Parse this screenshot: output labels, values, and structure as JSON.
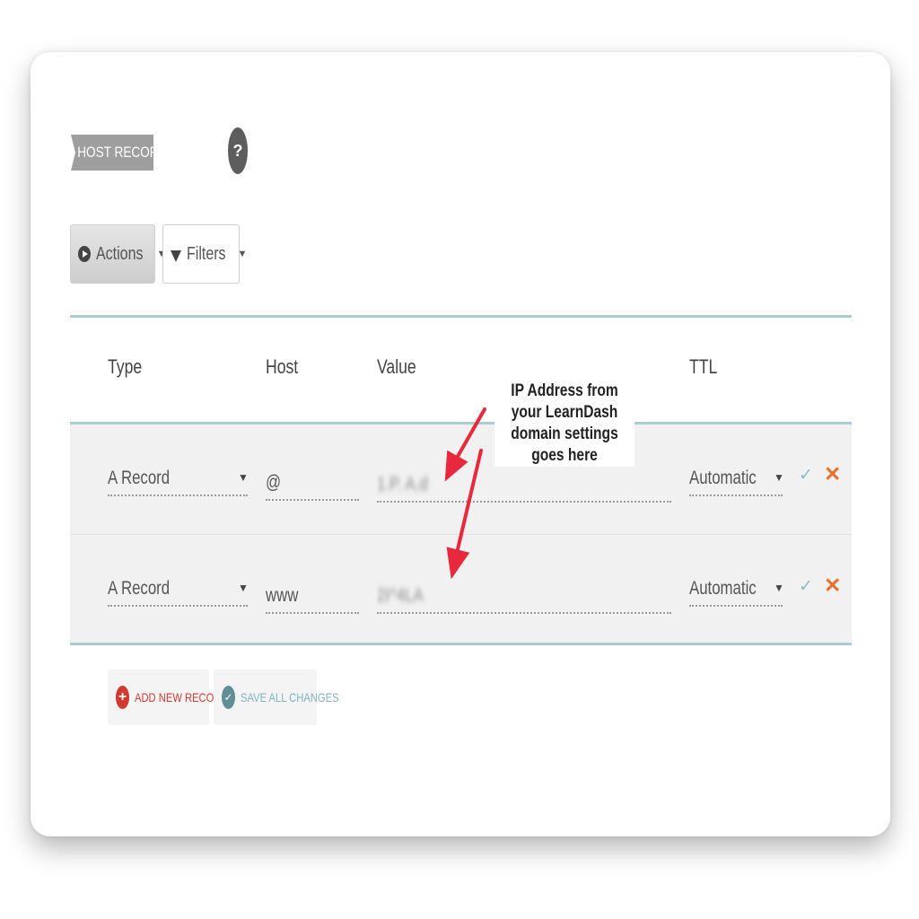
{
  "section": {
    "tag": "HOST RECORDS",
    "help_glyph": "?"
  },
  "toolbar": {
    "actions_label": "Actions",
    "filters_label": "Filters",
    "caret_glyph": "▼"
  },
  "table": {
    "headers": {
      "type": "Type",
      "host": "Host",
      "value": "Value",
      "ttl": "TTL"
    },
    "rows": [
      {
        "type": "A Record",
        "host": "@",
        "value": "1.P. A.d",
        "ttl": "Automatic",
        "save_glyph": "✓",
        "delete_glyph": "✕"
      },
      {
        "type": "A Record",
        "host": "www",
        "value": "2I^4LA",
        "ttl": "Automatic",
        "save_glyph": "✓",
        "delete_glyph": "✕"
      }
    ]
  },
  "footer": {
    "add_label": "ADD NEW RECORD",
    "save_label": "SAVE ALL CHANGES",
    "plus_glyph": "+",
    "check_glyph": "✓"
  },
  "annotation": {
    "line1": "IP Address from your LearnDash",
    "line2": "domain settings goes here"
  },
  "colors": {
    "accent_rule": "#a9cdd1",
    "add_red": "#d13a2f",
    "save_teal": "#7fb4bc",
    "delete_orange": "#e8702a",
    "arrow_red": "#e8283c"
  },
  "icons": {
    "help": "question-circle-icon",
    "actions": "play-circle-icon",
    "filters": "funnel-icon",
    "save_row": "check-icon",
    "delete_row": "close-icon",
    "add": "plus-circle-icon",
    "save_all": "check-circle-icon"
  }
}
